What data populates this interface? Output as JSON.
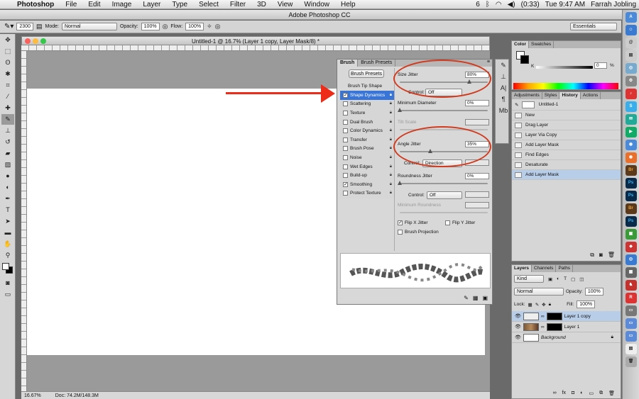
{
  "menubar": {
    "apple": "",
    "app": "Photoshop",
    "items": [
      "File",
      "Edit",
      "Image",
      "Layer",
      "Type",
      "Select",
      "Filter",
      "3D",
      "View",
      "Window",
      "Help"
    ],
    "right": {
      "battery": "(0:33)",
      "clock": "Tue 9:47 AM",
      "user": "Farrah Jobling",
      "badge": "6"
    }
  },
  "window_title": "Adobe Photoshop CC",
  "options": {
    "brush_size": "2300",
    "mode_label": "Mode:",
    "mode_value": "Normal",
    "opacity_label": "Opacity:",
    "opacity_value": "100%",
    "flow_label": "Flow:",
    "flow_value": "100%",
    "workspace": "Essentials"
  },
  "document": {
    "title": "Untitled-1 @ 16.7% (Layer 1 copy, Layer Mask/8) *",
    "zoom": "16.67%",
    "doc_size": "Doc: 74.2M/148.3M"
  },
  "brush_panel": {
    "tabs": [
      "Brush",
      "Brush Presets"
    ],
    "presets_button": "Brush Presets",
    "tip_shape": "Brush Tip Shape",
    "items": [
      {
        "label": "Shape Dynamics",
        "checked": "✓"
      },
      {
        "label": "Scattering",
        "checked": ""
      },
      {
        "label": "Texture",
        "checked": ""
      },
      {
        "label": "Dual Brush",
        "checked": ""
      },
      {
        "label": "Color Dynamics",
        "checked": ""
      },
      {
        "label": "Transfer",
        "checked": ""
      },
      {
        "label": "Brush Pose",
        "checked": ""
      },
      {
        "label": "Noise",
        "checked": ""
      },
      {
        "label": "Wet Edges",
        "checked": ""
      },
      {
        "label": "Build-up",
        "checked": ""
      },
      {
        "label": "Smoothing",
        "checked": "✓"
      },
      {
        "label": "Protect Texture",
        "checked": ""
      }
    ],
    "size_jitter_label": "Size Jitter",
    "size_jitter_value": "80%",
    "control_label": "Control:",
    "control_size": "Off",
    "min_diameter_label": "Minimum Diameter",
    "min_diameter_value": "0%",
    "tilt_scale_label": "Tilt Scale",
    "angle_jitter_label": "Angle Jitter",
    "angle_jitter_value": "35%",
    "control_angle": "Direction",
    "roundness_label": "Roundness Jitter",
    "roundness_value": "0%",
    "control_round": "Off",
    "min_roundness_label": "Minimum Roundness",
    "flipx": "Flip X Jitter",
    "flipy": "Flip Y Jitter",
    "projection": "Brush Projection"
  },
  "color_panel": {
    "tabs": [
      "Color",
      "Swatches"
    ],
    "k_label": "K",
    "k_value": "0",
    "pct": "%"
  },
  "history_panel": {
    "tabs": [
      "Adjustments",
      "Styles",
      "History",
      "Actions"
    ],
    "snapshot": "Untitled-1",
    "items": [
      "New",
      "Drag Layer",
      "Layer Via Copy",
      "Add Layer Mask",
      "Find Edges",
      "Desaturate",
      "Add Layer Mask"
    ]
  },
  "layers_panel": {
    "tabs": [
      "Layers",
      "Channels",
      "Paths"
    ],
    "kind": "Kind",
    "blend": "Normal",
    "opacity_label": "Opacity:",
    "opacity_value": "100%",
    "lock_label": "Lock:",
    "fill_label": "Fill:",
    "fill_value": "100%",
    "layers": [
      "Layer 1 copy",
      "Layer 1",
      "Background"
    ]
  },
  "dock": [
    "Br",
    "Ps",
    "Ps",
    "Br",
    "Ps"
  ]
}
